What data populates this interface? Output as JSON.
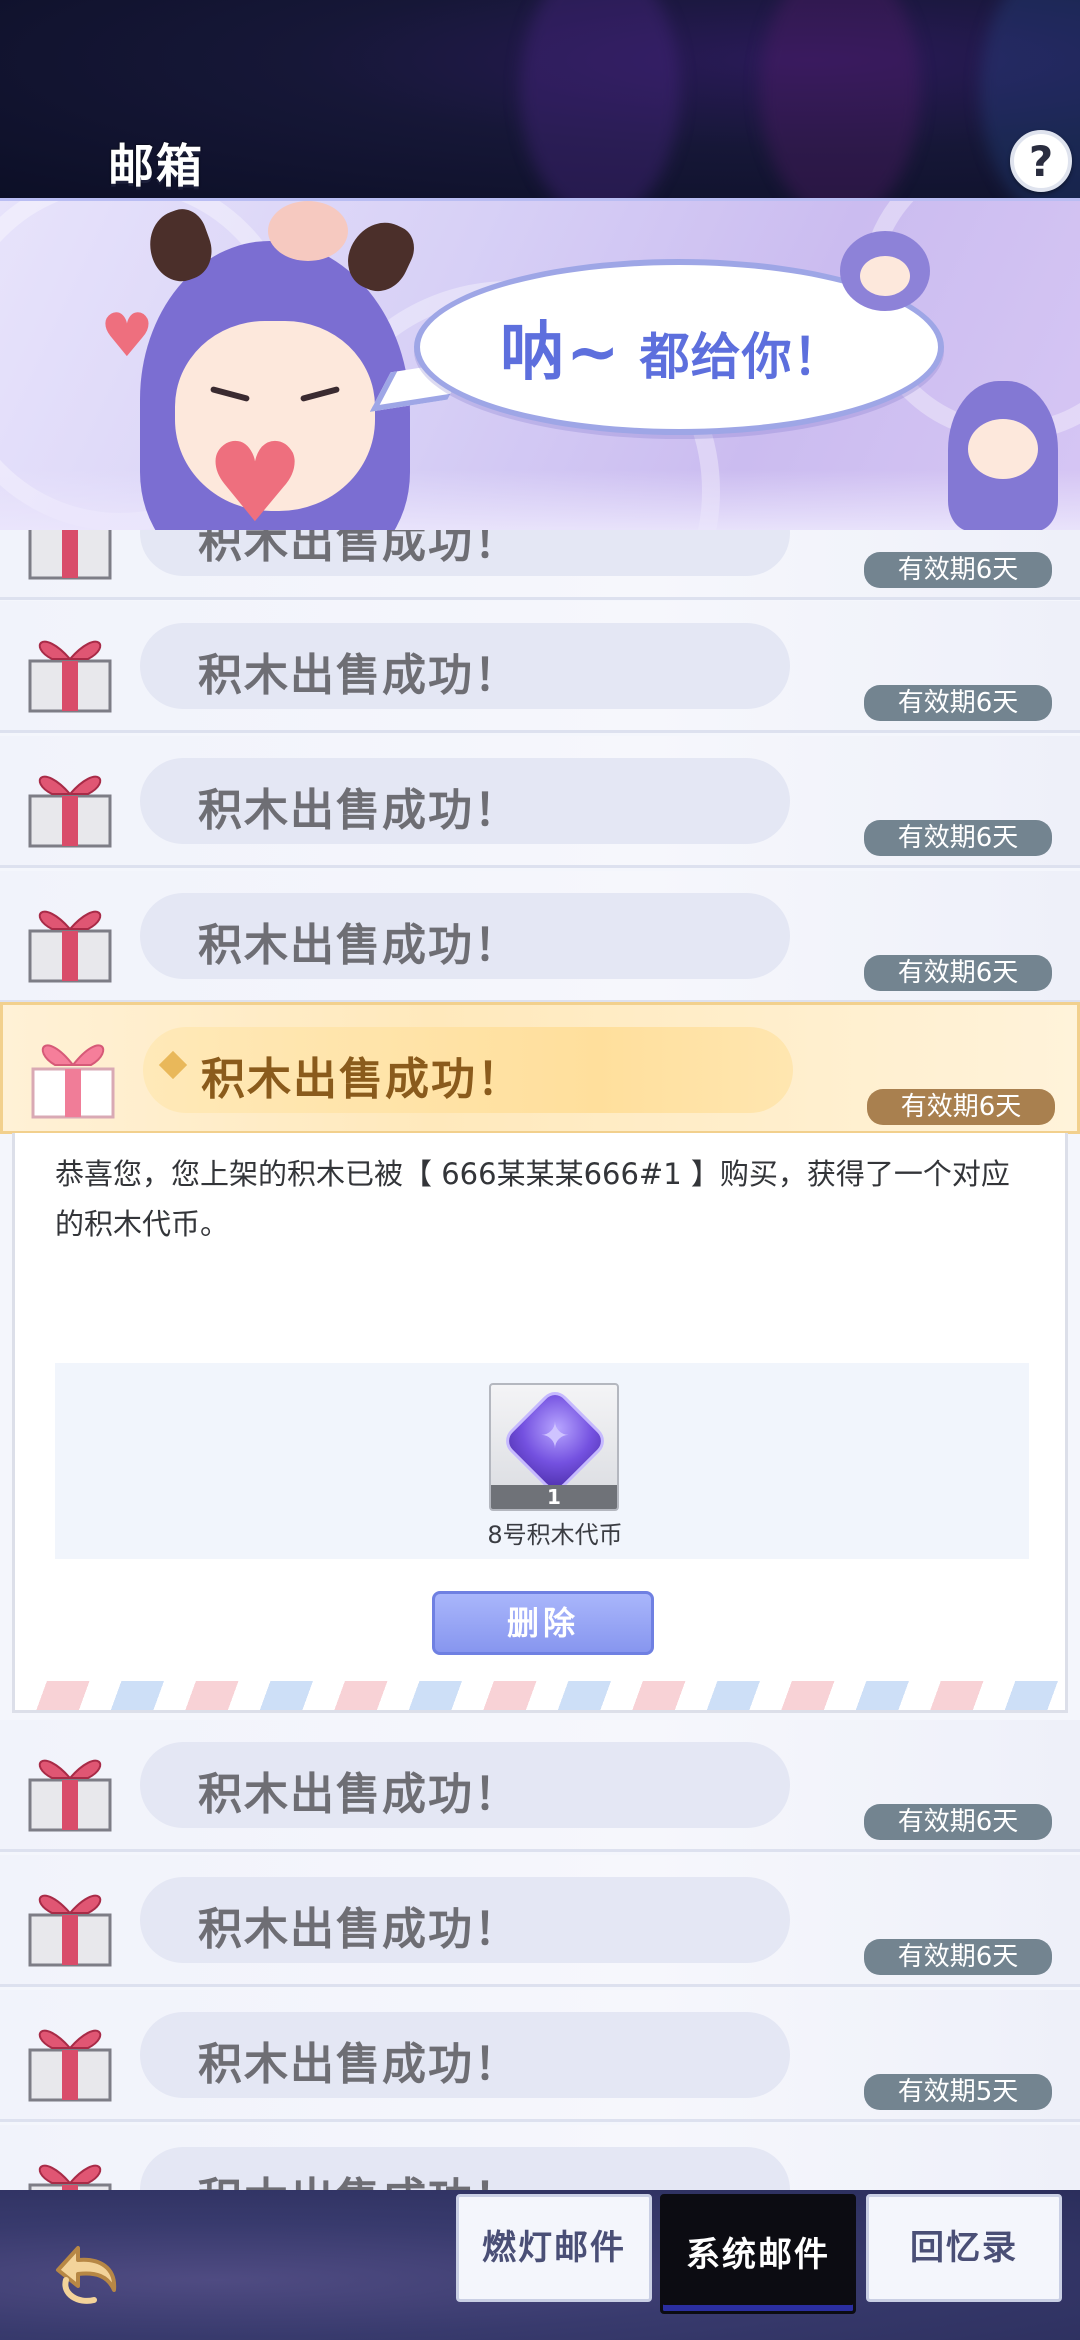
{
  "header": {
    "title": "邮箱",
    "help_label": "?"
  },
  "banner": {
    "speech_big": "呐~",
    "speech_small": "都给你！"
  },
  "mails": [
    {
      "subject": "积木出售成功！",
      "expiry": "有效期6天"
    },
    {
      "subject": "积木出售成功！",
      "expiry": "有效期6天"
    },
    {
      "subject": "积木出售成功！",
      "expiry": "有效期6天"
    },
    {
      "subject": "积木出售成功！",
      "expiry": "有效期6天"
    },
    {
      "subject": "积木出售成功！",
      "expiry": "有效期6天",
      "selected": true
    },
    {
      "subject": "积木出售成功！",
      "expiry": "有效期6天"
    },
    {
      "subject": "积木出售成功！",
      "expiry": "有效期6天"
    },
    {
      "subject": "积木出售成功！",
      "expiry": "有效期5天"
    },
    {
      "subject": "积木出售成功！",
      "expiry": ""
    }
  ],
  "detail": {
    "body": "恭喜您，您上架的积木已被【 666某某某666#1 】购买，获得了一个对应的积木代币。",
    "attachment": {
      "name": "8号积木代币",
      "count": "1",
      "icon": "purple-gem-icon"
    },
    "delete_label": "删除"
  },
  "tabs": [
    {
      "label": "燃灯邮件",
      "active": false
    },
    {
      "label": "系统邮件",
      "active": true
    },
    {
      "label": "回忆录",
      "active": false
    }
  ],
  "colors": {
    "accent": "#8796ef",
    "selected_row": "#ffe9bc",
    "expiry_badge": "#738490"
  }
}
